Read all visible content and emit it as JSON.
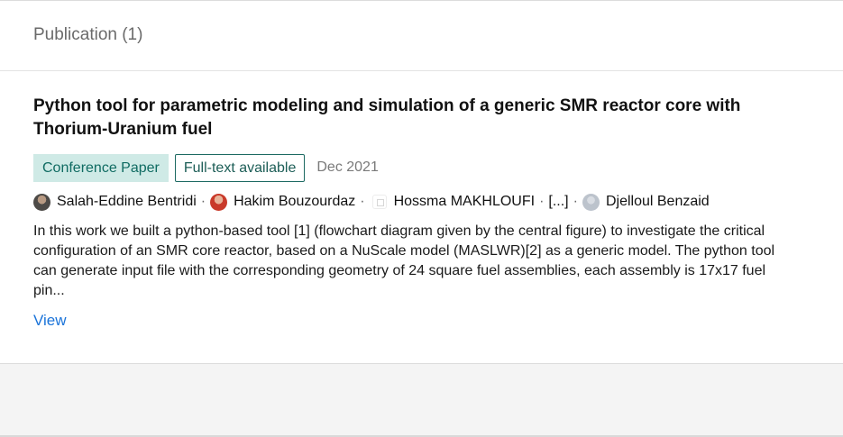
{
  "section": {
    "title": "Publication (1)"
  },
  "publication": {
    "title": "Python tool for parametric modeling and simulation of a generic SMR reactor core with Thorium-Uranium fuel",
    "type_badge": "Conference Paper",
    "fulltext_badge": "Full-text available",
    "date": "Dec 2021",
    "authors": [
      {
        "name": "Salah-Eddine Bentridi",
        "avatar": "profile-photo"
      },
      {
        "name": "Hakim Bouzourdaz",
        "avatar": "profile-photo"
      },
      {
        "name": "Hossma MAKHLOUFI",
        "avatar": "placeholder-icon"
      },
      {
        "name": "Djelloul Benzaid",
        "avatar": "default-avatar"
      }
    ],
    "more_authors": "[...]",
    "separator": "·",
    "abstract": "In this work we built a python-based tool [1] (flowchart diagram given by the central figure) to investigate the critical configuration of an SMR core reactor, based on a NuScale model (MASLWR)[2] as a generic model. The python tool can generate input file with the corresponding geometry of 24 square fuel assemblies, each assembly is 17x17 fuel pin...",
    "view_label": "View"
  },
  "colors": {
    "badge_type_bg": "#cfeae6",
    "badge_type_text": "#0f6b62",
    "link": "#1a73d9"
  }
}
